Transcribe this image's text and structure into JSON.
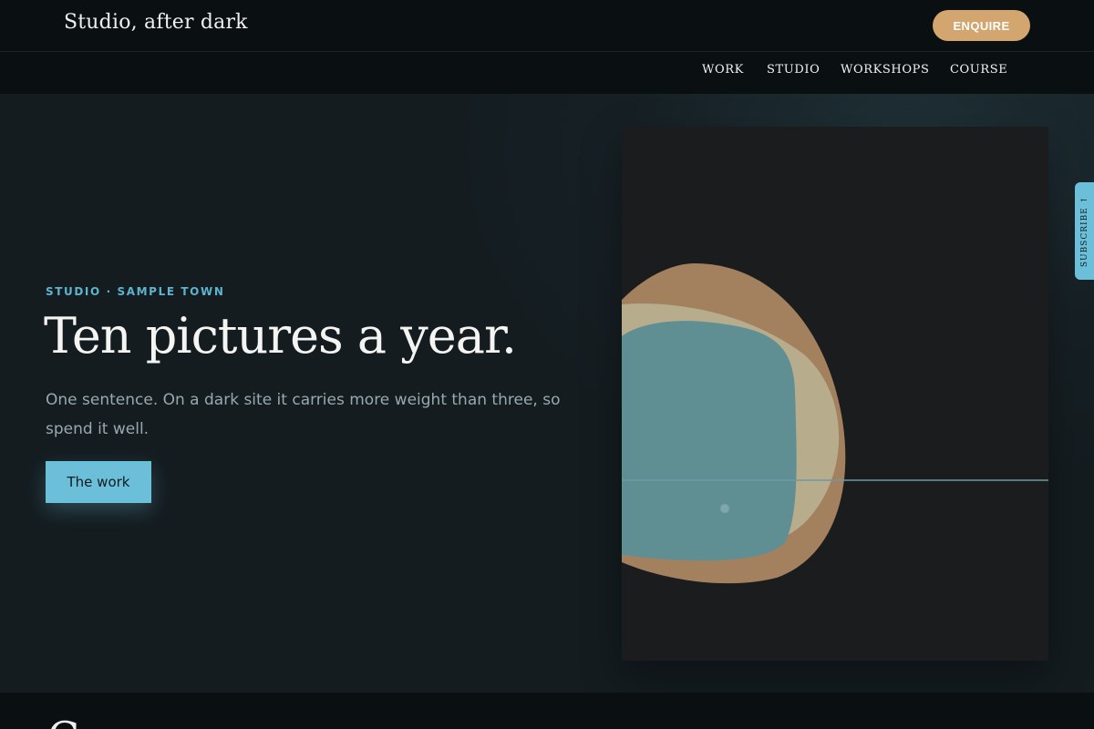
{
  "header": {
    "brand": "Studio, after dark",
    "enquire_label": "ENQUIRE"
  },
  "nav": {
    "items": [
      {
        "label": "WORK"
      },
      {
        "label": "STUDIO"
      },
      {
        "label": "WORKSHOPS"
      },
      {
        "label": "COURSE"
      }
    ]
  },
  "hero": {
    "eyebrow": "STUDIO · SAMPLE TOWN",
    "headline": "Ten pictures a year.",
    "lede": "One sentence. On a dark site it carries more weight than three, so spend it well.",
    "cta_label": "The work"
  },
  "side_tab": {
    "label": "SUBSCRIBE",
    "icon": "arrow-up-icon"
  },
  "next_section": {
    "heading": "C"
  },
  "colors": {
    "accent_blue": "#6cbfd9",
    "accent_gold": "#d3a56f",
    "hero_bg": "#162024",
    "bar_bg": "#0a0f12"
  }
}
